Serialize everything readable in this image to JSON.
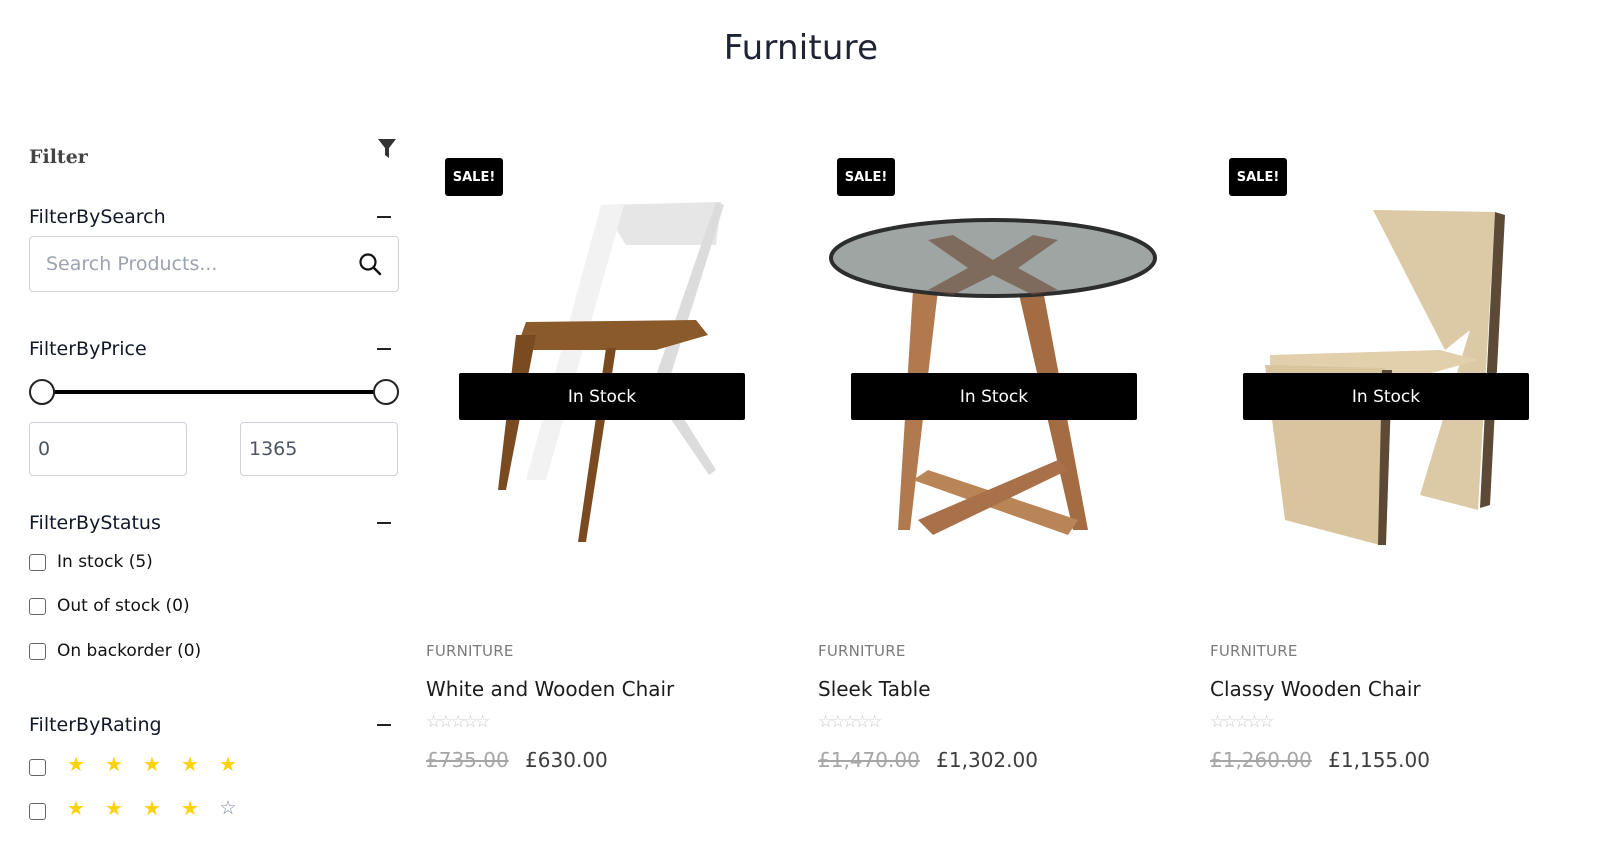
{
  "page": {
    "title": "Furniture"
  },
  "sidebar": {
    "filter_title": "Filter",
    "search": {
      "title": "FilterBySearch",
      "placeholder": "Search Products...",
      "value": ""
    },
    "price": {
      "title": "FilterByPrice",
      "min_value": "0",
      "max_value": "1365",
      "range_low_fraction": 0,
      "range_high_fraction": 1
    },
    "status": {
      "title": "FilterByStatus",
      "options": [
        {
          "label": "In stock (5)",
          "checked": false
        },
        {
          "label": "Out of stock (0)",
          "checked": false
        },
        {
          "label": "On backorder (0)",
          "checked": false
        }
      ]
    },
    "rating": {
      "title": "FilterByRating",
      "options": [
        {
          "stars": 5,
          "of": 5,
          "checked": false
        },
        {
          "stars": 4,
          "of": 5,
          "checked": false
        }
      ]
    }
  },
  "colors": {
    "star_filled": "#fdd20a",
    "badge_bg": "#000000",
    "title_color": "#1e2433"
  },
  "products": [
    {
      "badge": "SALE!",
      "stock": "In Stock",
      "category": "FURNITURE",
      "name": "White and Wooden Chair",
      "rating": 0,
      "old_price": "£735.00",
      "price": "£630.00"
    },
    {
      "badge": "SALE!",
      "stock": "In Stock",
      "category": "FURNITURE",
      "name": "Sleek Table",
      "rating": 0,
      "old_price": "£1,470.00",
      "price": "£1,302.00"
    },
    {
      "badge": "SALE!",
      "stock": "In Stock",
      "category": "FURNITURE",
      "name": "Classy Wooden Chair",
      "rating": 0,
      "old_price": "£1,260.00",
      "price": "£1,155.00"
    }
  ]
}
